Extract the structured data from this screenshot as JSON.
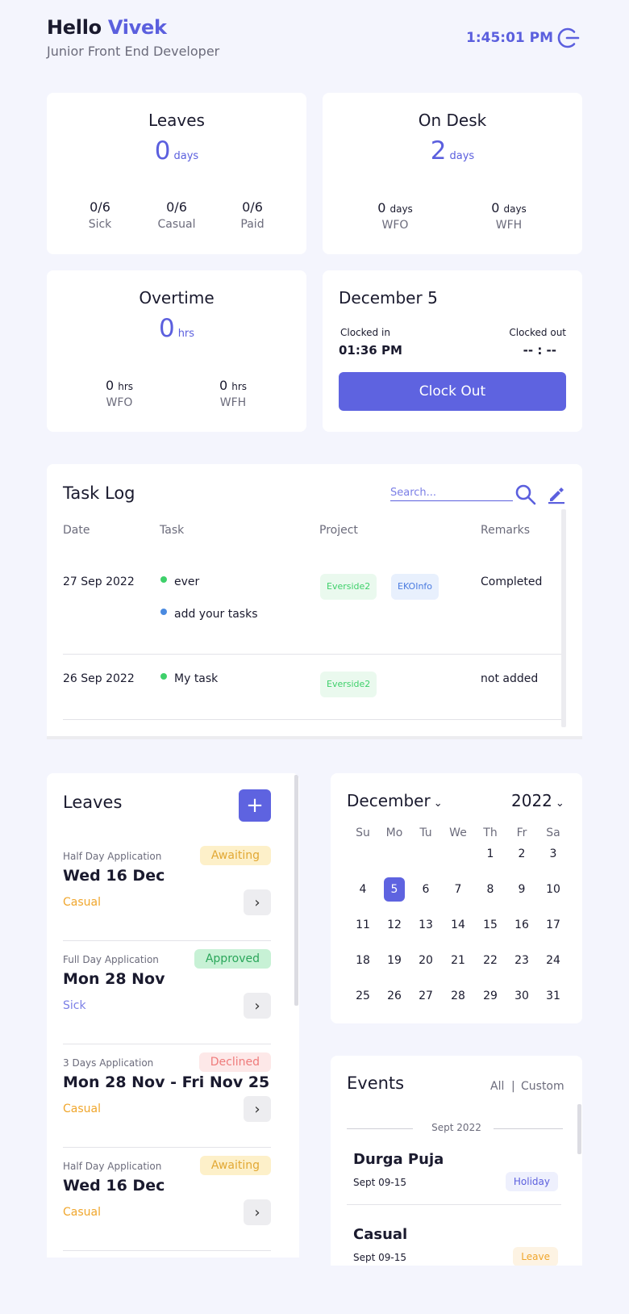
{
  "header": {
    "greeting": "Hello",
    "name": "Vivek",
    "role": "Junior Front End Developer",
    "time": "1:45:01 PM"
  },
  "leaves_card": {
    "title": "Leaves",
    "value": "0",
    "unit": "days",
    "stats": [
      {
        "value": "0/6",
        "label": "Sick"
      },
      {
        "value": "0/6",
        "label": "Casual"
      },
      {
        "value": "0/6",
        "label": "Paid"
      }
    ]
  },
  "ondesk_card": {
    "title": "On Desk",
    "value": "2",
    "unit": "days",
    "stats": [
      {
        "value": "0",
        "unit": "days",
        "label": "WFO"
      },
      {
        "value": "0",
        "unit": "days",
        "label": "WFH"
      }
    ]
  },
  "overtime_card": {
    "title": "Overtime",
    "value": "0",
    "unit": "hrs",
    "stats": [
      {
        "value": "0",
        "unit": "hrs",
        "label": "WFO"
      },
      {
        "value": "0",
        "unit": "hrs",
        "label": "WFH"
      }
    ]
  },
  "clock_card": {
    "date": "December 5",
    "clocked_in_label": "Clocked in",
    "clocked_in_value": "01:36 PM",
    "clocked_out_label": "Clocked out",
    "clocked_out_value": "-- : --",
    "button": "Clock Out"
  },
  "task_log": {
    "title": "Task Log",
    "search_placeholder": "Search...",
    "columns": [
      "Date",
      "Task",
      "Project",
      "Remarks"
    ],
    "rows": [
      {
        "date": "27 Sep 2022",
        "tasks": [
          "ever",
          "add your tasks"
        ],
        "projects": [
          "Everside2",
          "EKOInfo"
        ],
        "remarks": "Completed"
      },
      {
        "date": "26 Sep 2022",
        "tasks": [
          "My task"
        ],
        "projects": [
          "Everside2"
        ],
        "remarks": "not added"
      }
    ]
  },
  "leaves_list": {
    "title": "Leaves",
    "add_label": "+",
    "items": [
      {
        "type": "Half Day Application",
        "date": "Wed 16 Dec",
        "category": "Casual",
        "status": "Awaiting"
      },
      {
        "type": "Full Day Application",
        "date": "Mon 28 Nov",
        "category": "Sick",
        "status": "Approved"
      },
      {
        "type": "3 Days Application",
        "date": "Mon 28 Nov - Fri Nov 25",
        "category": "Casual",
        "status": "Declined"
      },
      {
        "type": "Half Day Application",
        "date": "Wed 16 Dec",
        "category": "Casual",
        "status": "Awaiting"
      }
    ]
  },
  "calendar": {
    "month": "December",
    "year": "2022",
    "weekdays": [
      "Su",
      "Mo",
      "Tu",
      "We",
      "Th",
      "Fr",
      "Sa"
    ],
    "selected_day": 5
  },
  "events": {
    "title": "Events",
    "filter_all": "All",
    "filter_sep": "|",
    "filter_custom": "Custom",
    "group_label": "Sept 2022",
    "items": [
      {
        "name": "Durga Puja",
        "date": "Sept 09-15",
        "tag": "Holiday"
      },
      {
        "name": "Casual",
        "date": "Sept 09-15",
        "tag": "Leave"
      }
    ]
  },
  "colors": {
    "accent": "#5e63e0",
    "background": "#f4f5fd",
    "casual": "#f0a62c",
    "sick": "#7b7fe6"
  }
}
